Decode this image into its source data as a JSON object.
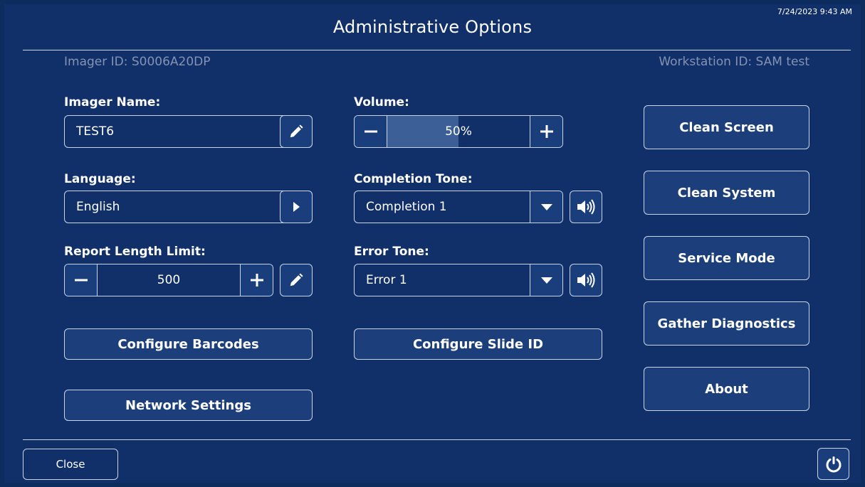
{
  "header": {
    "title": "Administrative Options",
    "datetime": "7/24/2023 9:43 AM",
    "imager_id": "Imager ID: S0006A20DP",
    "workstation_id": "Workstation ID: SAM test"
  },
  "imager_name": {
    "label": "Imager Name:",
    "value": "TEST6",
    "edit_icon": "pencil-icon"
  },
  "language": {
    "label": "Language:",
    "value": "English",
    "arrow_icon": "play-right-icon"
  },
  "report_length": {
    "label": "Report Length Limit:",
    "value": "500"
  },
  "volume": {
    "label": "Volume:",
    "value": "50%",
    "level": 0.5
  },
  "completion_tone": {
    "label": "Completion Tone:",
    "value": "Completion 1"
  },
  "error_tone": {
    "label": "Error Tone:",
    "value": "Error 1"
  },
  "buttons": {
    "configure_barcodes": "Configure Barcodes",
    "configure_slide_id": "Configure Slide ID",
    "network_settings": "Network Settings"
  },
  "side_buttons": {
    "clean_screen": "Clean Screen",
    "clean_system": "Clean System",
    "service_mode": "Service Mode",
    "gather_diagnostics": "Gather Diagnostics",
    "about": "About"
  },
  "footer": {
    "close": "Close"
  },
  "colors": {
    "background": "#11306a",
    "button": "#1c3f7c",
    "border": "#c9d4ea",
    "muted_text": "#8493b3",
    "volume_fill": "#3c5f97"
  }
}
